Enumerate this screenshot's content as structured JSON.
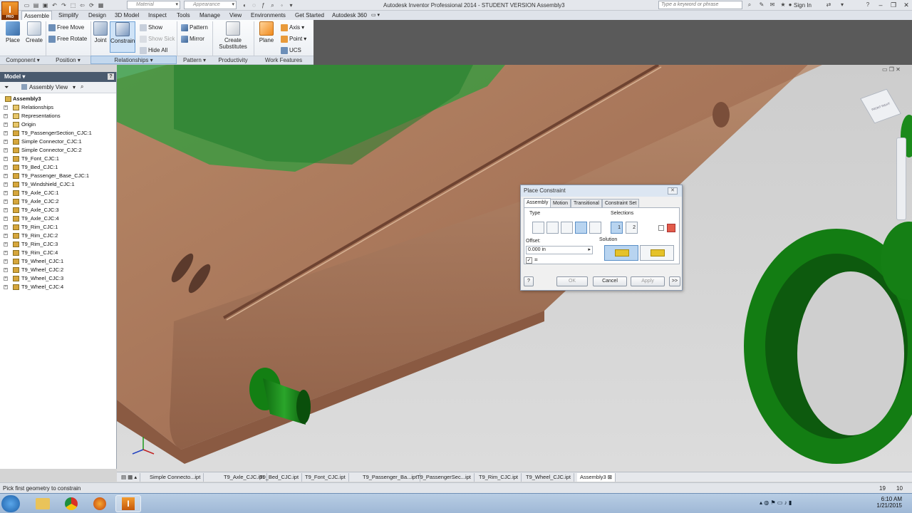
{
  "titlebar": {
    "app_logo": "I",
    "app_edition": "PRO",
    "material_combo": "Material",
    "appearance_combo": "Appearance",
    "window_title": "Autodesk Inventor Professional 2014 - STUDENT VERSION    Assembly3",
    "search_placeholder": "Type a keyword or phrase",
    "sign_in": "Sign In"
  },
  "ribbon_tabs": [
    "Assemble",
    "Simplify",
    "Design",
    "3D Model",
    "Inspect",
    "Tools",
    "Manage",
    "View",
    "Environments",
    "Get Started",
    "Autodesk 360"
  ],
  "ribbon": {
    "component": {
      "place": "Place",
      "create": "Create",
      "title": "Component"
    },
    "position": {
      "free_move": "Free Move",
      "free_rotate": "Free Rotate",
      "title": "Position"
    },
    "relationships": {
      "joint": "Joint",
      "constrain": "Constrain",
      "show": "Show",
      "show_sick": "Show Sick",
      "hide_all": "Hide All",
      "title": "Relationships"
    },
    "pattern": {
      "pattern": "Pattern",
      "mirror": "Mirror",
      "title": "Pattern"
    },
    "productivity": {
      "create": "Create",
      "substitutes": "Substitutes",
      "title": "Productivity"
    },
    "work_features": {
      "plane": "Plane",
      "axis": "Axis",
      "point": "Point",
      "ucs": "UCS",
      "title": "Work Features"
    }
  },
  "browser": {
    "title": "Model",
    "view": "Assembly View",
    "root": "Assembly3",
    "items": [
      "Relationships",
      "Representations",
      "Origin",
      "T9_PassengerSection_CJC:1",
      "Simple Connector_CJC:1",
      "Simple Connector_CJC:2",
      "T9_Font_CJC:1",
      "T9_Bed_CJC:1",
      "T9_Passenger_Base_CJC:1",
      "T9_Windshield_CJC:1",
      "T9_Axle_CJC:1",
      "T9_Axle_CJC:2",
      "T9_Axle_CJC:3",
      "T9_Axle_CJC:4",
      "T9_Rim_CJC:1",
      "T9_Rim_CJC:2",
      "T9_Rim_CJC:3",
      "T9_Rim_CJC:4",
      "T9_Wheel_CJC:1",
      "T9_Wheel_CJC:2",
      "T9_Wheel_CJC:3",
      "T9_Wheel_CJC:4"
    ]
  },
  "dialog": {
    "title": "Place Constraint",
    "tabs": [
      "Assembly",
      "Motion",
      "Transitional",
      "Constraint Set"
    ],
    "type_label": "Type",
    "selections_label": "Selections",
    "offset_label": "Offset:",
    "offset_value": "0.000 in",
    "solution_label": "Solution",
    "ok": "OK",
    "cancel": "Cancel",
    "apply": "Apply",
    "more": ">>",
    "help": "?",
    "sel1": "1",
    "sel2": "2"
  },
  "viewcube": {
    "top": "TOP",
    "front": "FRONT",
    "right": "RIGHT"
  },
  "doc_tabs": [
    "Simple Connecto...ipt",
    "T9_Axle_CJC.ipt",
    "T9_Bed_CJC.ipt",
    "T9_Font_CJC.ipt",
    "T9_Passenger_Ba...ipt",
    "T9_PassengerSec...ipt",
    "T9_Rim_CJC.ipt",
    "T9_Wheel_CJC.ipt",
    "Assembly3"
  ],
  "status": {
    "message": "Pick first geometry to constrain",
    "count1": "19",
    "count2": "10"
  },
  "taskbar": {
    "time": "6:10 AM",
    "date": "1/21/2015"
  },
  "colors": {
    "wood": "#a8765a",
    "green": "#1f8a1f",
    "viewport_bg": "#d0d0d0",
    "accent_blue": "#4a5a6e"
  }
}
